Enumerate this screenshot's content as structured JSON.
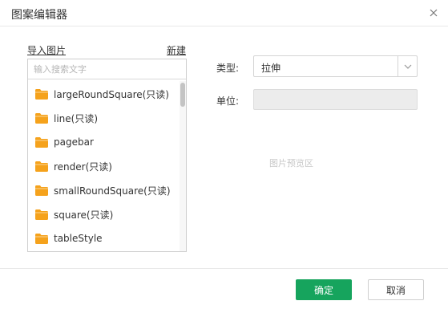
{
  "dialog": {
    "title": "图案编辑器",
    "close_icon": "close-icon"
  },
  "left": {
    "import_label": "导入图片",
    "new_label": "新建",
    "search_placeholder": "输入搜索文字",
    "folder_icon": "folder-icon",
    "folder_color": "#f5a21c",
    "items": [
      {
        "label": "largeRoundSquare(只读)"
      },
      {
        "label": "line(只读)"
      },
      {
        "label": "pagebar"
      },
      {
        "label": "render(只读)"
      },
      {
        "label": "smallRoundSquare(只读)"
      },
      {
        "label": "square(只读)"
      },
      {
        "label": "tableStyle"
      }
    ]
  },
  "form": {
    "type_label": "类型:",
    "type_value": "拉伸",
    "unit_label": "单位:",
    "unit_value": ""
  },
  "preview": {
    "placeholder": "图片预览区"
  },
  "footer": {
    "ok_label": "确定",
    "cancel_label": "取消",
    "ok_color": "#16a45d"
  }
}
